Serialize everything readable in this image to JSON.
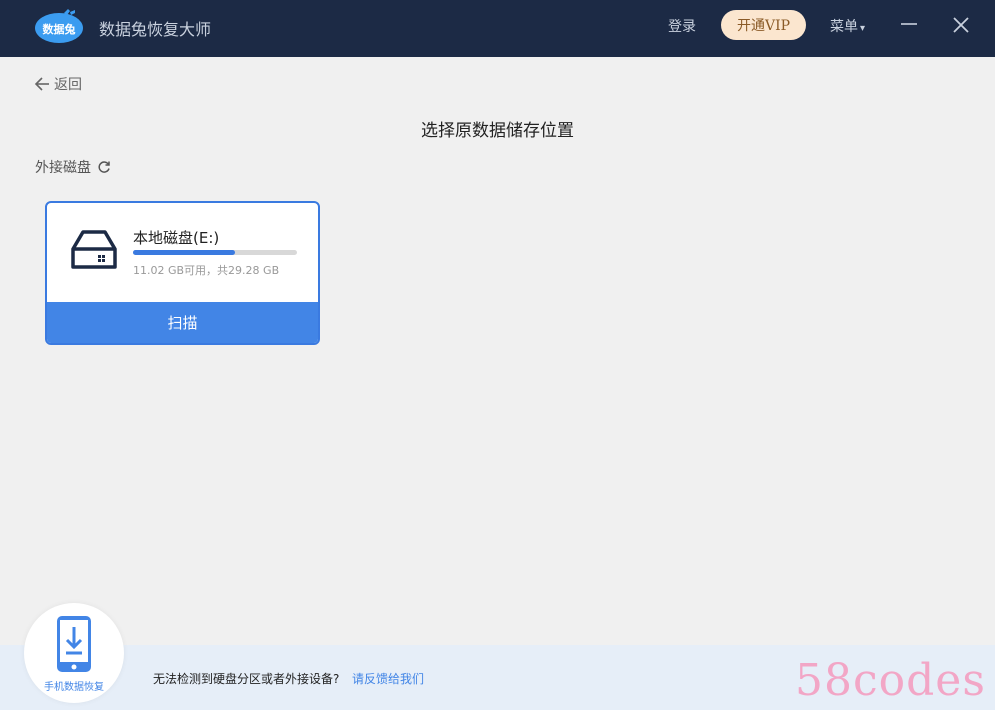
{
  "titlebar": {
    "logo_text": "数据兔",
    "app_title": "数据兔恢复大师",
    "login_label": "登录",
    "vip_label": "开通VIP",
    "menu_label": "菜单",
    "menu_caret": "▾"
  },
  "nav": {
    "back_label": "返回"
  },
  "page": {
    "title": "选择原数据储存位置",
    "section_label": "外接磁盘"
  },
  "disk": {
    "name": "本地磁盘(E:)",
    "info": "11.02 GB可用，共29.28 GB",
    "used_fraction": 0.62,
    "scan_label": "扫描"
  },
  "bottom": {
    "phone_label": "手机数据恢复",
    "prompt": "无法检测到硬盘分区或者外接设备?",
    "feedback_link": "请反馈给我们"
  },
  "watermark": "58codes",
  "colors": {
    "titlebar_bg": "#1c2a45",
    "accent": "#4285e6",
    "vip_bg": "#fbe6cf"
  }
}
